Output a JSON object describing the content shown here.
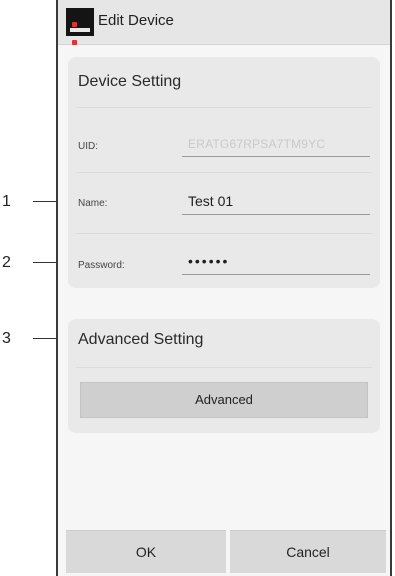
{
  "callouts": [
    "1",
    "2",
    "3"
  ],
  "header": {
    "title": "Edit Device",
    "icon": "app-logo-icon"
  },
  "device_setting": {
    "title": "Device Setting",
    "uid": {
      "label": "UID:",
      "value": "ERATG67RPSA7TM9YC"
    },
    "name": {
      "label": "Name:",
      "value": "Test 01"
    },
    "password": {
      "label": "Password:",
      "value": "••••••"
    }
  },
  "advanced_setting": {
    "title": "Advanced Setting",
    "button_label": "Advanced"
  },
  "footer": {
    "ok_label": "OK",
    "cancel_label": "Cancel"
  }
}
